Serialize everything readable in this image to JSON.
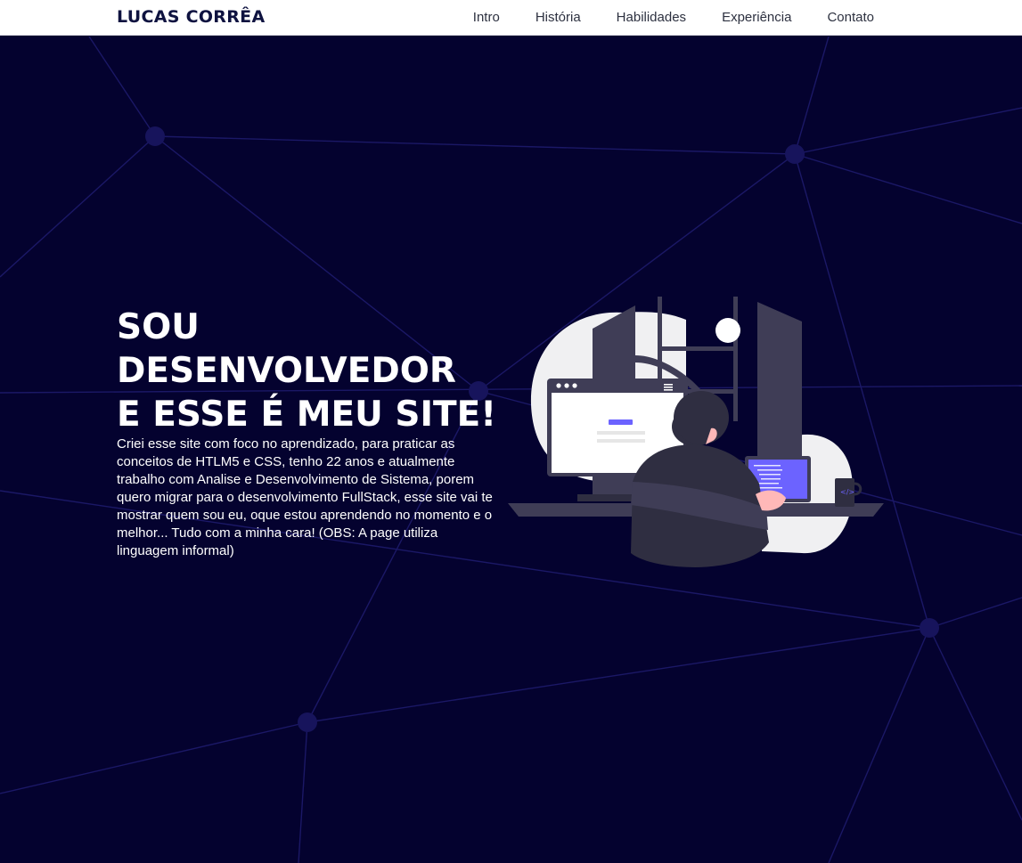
{
  "brand": "LUCAS CORRÊA",
  "nav": {
    "items": [
      "Intro",
      "História",
      "Habilidades",
      "Experiência",
      "Contato"
    ]
  },
  "hero": {
    "headline_lines": [
      "SOU",
      "DESENVOLVEDOR",
      "E ESSE É MEU SITE!"
    ],
    "description": "Criei esse site com foco no aprendizado, para praticar as conceitos de HTLM5 e CSS, tenho 22 anos e atualmente trabalho com Analise e Desenvolvimento de Sistema, porem quero migrar para o desenvolvimento FullStack, esse site vai te mostrar quem sou eu, oque estou aprendendo no momento e o melhor... Tudo com a minha cara! (OBS: A page utiliza linguagem informal)"
  },
  "colors": {
    "background": "#04022f",
    "network_line": "#1b1866",
    "network_node": "#17145c",
    "accent": "#6c63ff",
    "navbar": "#ffffff",
    "brand_text": "#0f1340"
  },
  "illustration": {
    "icon": "developer-at-computer-illustration"
  }
}
